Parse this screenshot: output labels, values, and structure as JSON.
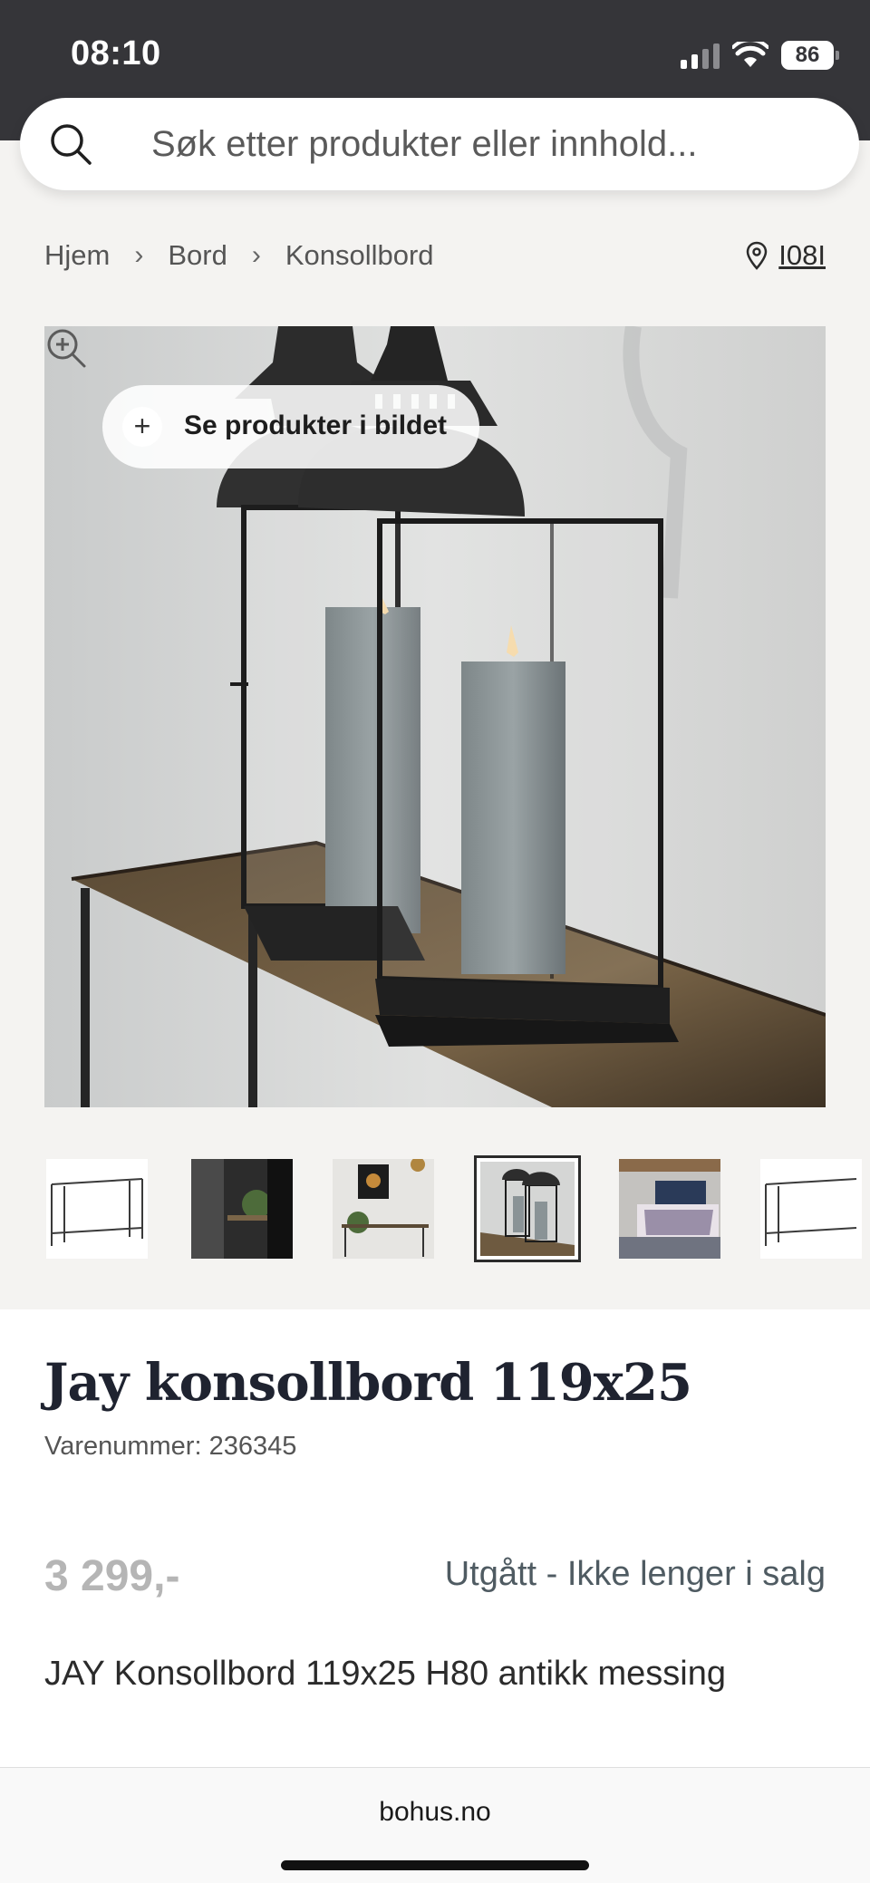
{
  "status_bar": {
    "time": "08:10",
    "battery": "86"
  },
  "search": {
    "placeholder": "Søk etter produkter eller innhold..."
  },
  "breadcrumb": {
    "items": [
      "Hjem",
      "Bord",
      "Konsollbord"
    ]
  },
  "store": {
    "label": "I08I"
  },
  "hero": {
    "hotspot_label": "Se produkter i bildet"
  },
  "thumbnails": {
    "count": 6,
    "active_index": 3
  },
  "product": {
    "title": "Jay konsollbord 119x25",
    "sku": "Varenummer: 236345",
    "price": "3 299,-",
    "availability": "Utgått - Ikke lenger i salg",
    "description": "JAY Konsollbord 119x25 H80 antikk messing"
  },
  "browser": {
    "url": "bohus.no"
  },
  "colors": {
    "status_bg": "#353539",
    "page_bg": "#f4f3f1",
    "title": "#1f2330",
    "availability": "#4f5b62",
    "price_disabled": "#b5b5b5"
  }
}
